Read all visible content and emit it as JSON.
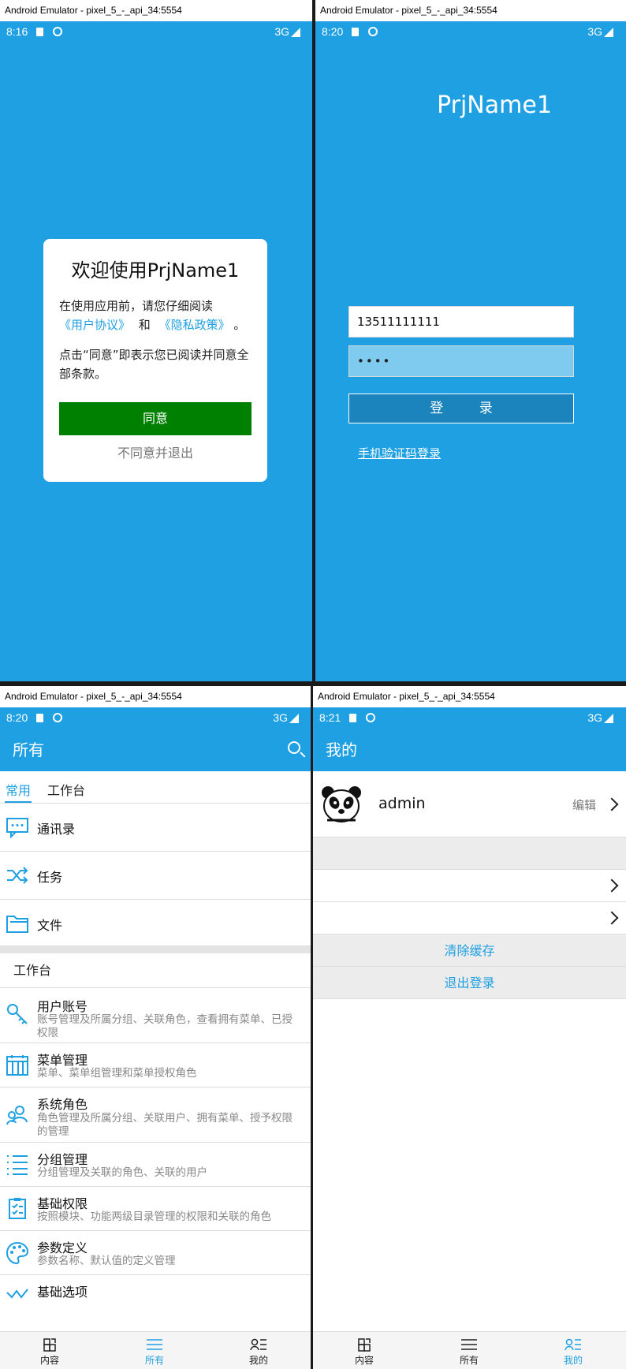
{
  "window_title": "Android Emulator - pixel_5_-_api_34:5554",
  "screens": {
    "welcome": {
      "status": {
        "time": "8:16",
        "network": "3G"
      },
      "dialog": {
        "title": "欢迎使用PrjName1",
        "line1": "在使用应用前，请您仔细阅读",
        "link_user": "《用户协议》",
        "and": "和",
        "link_privacy": "《隐私政策》",
        "period": "。",
        "line2": "点击“同意”即表示您已阅读并同意全部条款。",
        "agree": "同意",
        "disagree": "不同意并退出"
      }
    },
    "login": {
      "status": {
        "time": "8:20",
        "network": "3G"
      },
      "app_name": "PrjName1",
      "phone_value": "13511111111",
      "password_masked": "••••",
      "login_button": "登 录",
      "sms_login": "手机验证码登录"
    },
    "all": {
      "status": {
        "time": "8:20",
        "network": "3G"
      },
      "title": "所有",
      "tabs": [
        "常用",
        "工作台"
      ],
      "common": [
        "通讯录",
        "任务",
        "文件"
      ],
      "section_title": "工作台",
      "workbench": [
        {
          "title": "用户账号",
          "desc": "账号管理及所属分组、关联角色，查看拥有菜单、已授权限"
        },
        {
          "title": "菜单管理",
          "desc": "菜单、菜单组管理和菜单授权角色"
        },
        {
          "title": "系统角色",
          "desc": "角色管理及所属分组、关联用户、拥有菜单、授予权限的管理"
        },
        {
          "title": "分组管理",
          "desc": "分组管理及关联的角色、关联的用户"
        },
        {
          "title": "基础权限",
          "desc": "按照模块、功能两级目录管理的权限和关联的角色"
        },
        {
          "title": "参数定义",
          "desc": "参数名称、默认值的定义管理"
        },
        {
          "title": "基础选项",
          "desc": ""
        }
      ]
    },
    "mine": {
      "status": {
        "time": "8:21",
        "network": "3G"
      },
      "title": "我的",
      "username": "admin",
      "edit": "编辑",
      "clear_cache": "清除缓存",
      "logout": "退出登录"
    }
  },
  "bottom_nav": [
    "内容",
    "所有",
    "我的"
  ],
  "colors": {
    "primary": "#1fa0e2",
    "agree": "#008000"
  }
}
